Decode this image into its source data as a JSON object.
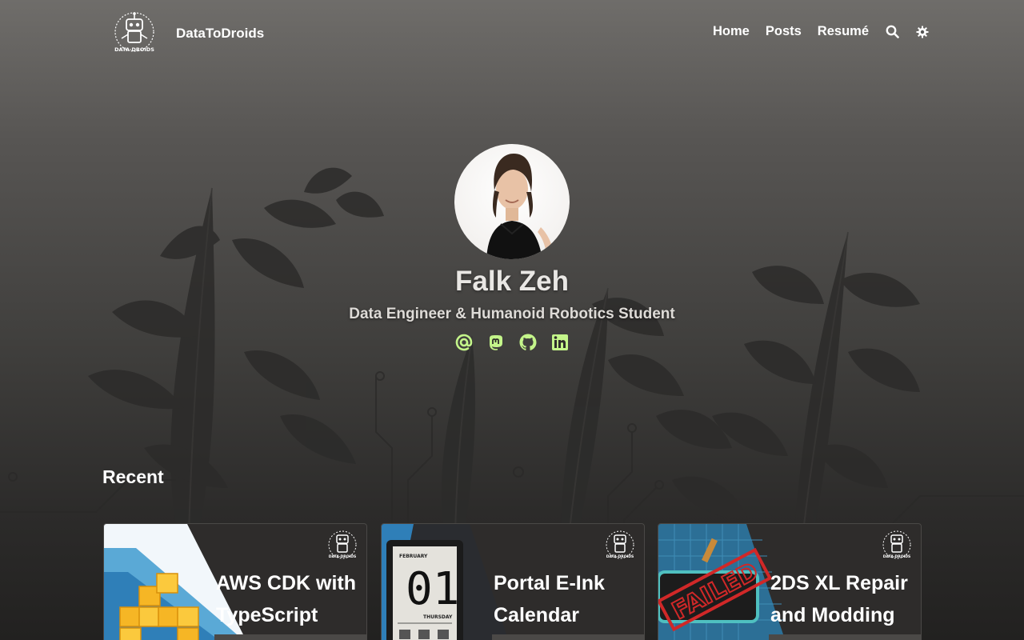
{
  "header": {
    "site_name": "DataToDroids",
    "logo_icon": "robot-logo-icon",
    "nav": [
      {
        "label": "Home"
      },
      {
        "label": "Posts"
      },
      {
        "label": "Resumé"
      }
    ],
    "search_icon": "search-icon",
    "theme_icon": "gear-icon"
  },
  "hero": {
    "name": "Falk Zeh",
    "tagline": "Data Engineer & Humanoid Robotics Student",
    "socials": [
      {
        "icon": "email-icon"
      },
      {
        "icon": "mastodon-icon"
      },
      {
        "icon": "github-icon"
      },
      {
        "icon": "linkedin-icon"
      }
    ]
  },
  "recent": {
    "title": "Recent",
    "cards": [
      {
        "title": "AWS CDK with TypeScript"
      },
      {
        "title": "Portal E-Ink Calendar",
        "thumb_text": [
          "FEBRUARY",
          "01",
          "THURSDAY"
        ]
      },
      {
        "title": "2DS XL Repair and Modding",
        "stamp": "FAILED"
      }
    ]
  },
  "colors": {
    "accent": "#c4f58a",
    "text": "#ffffff",
    "card_bg": "#2e2c2b"
  }
}
